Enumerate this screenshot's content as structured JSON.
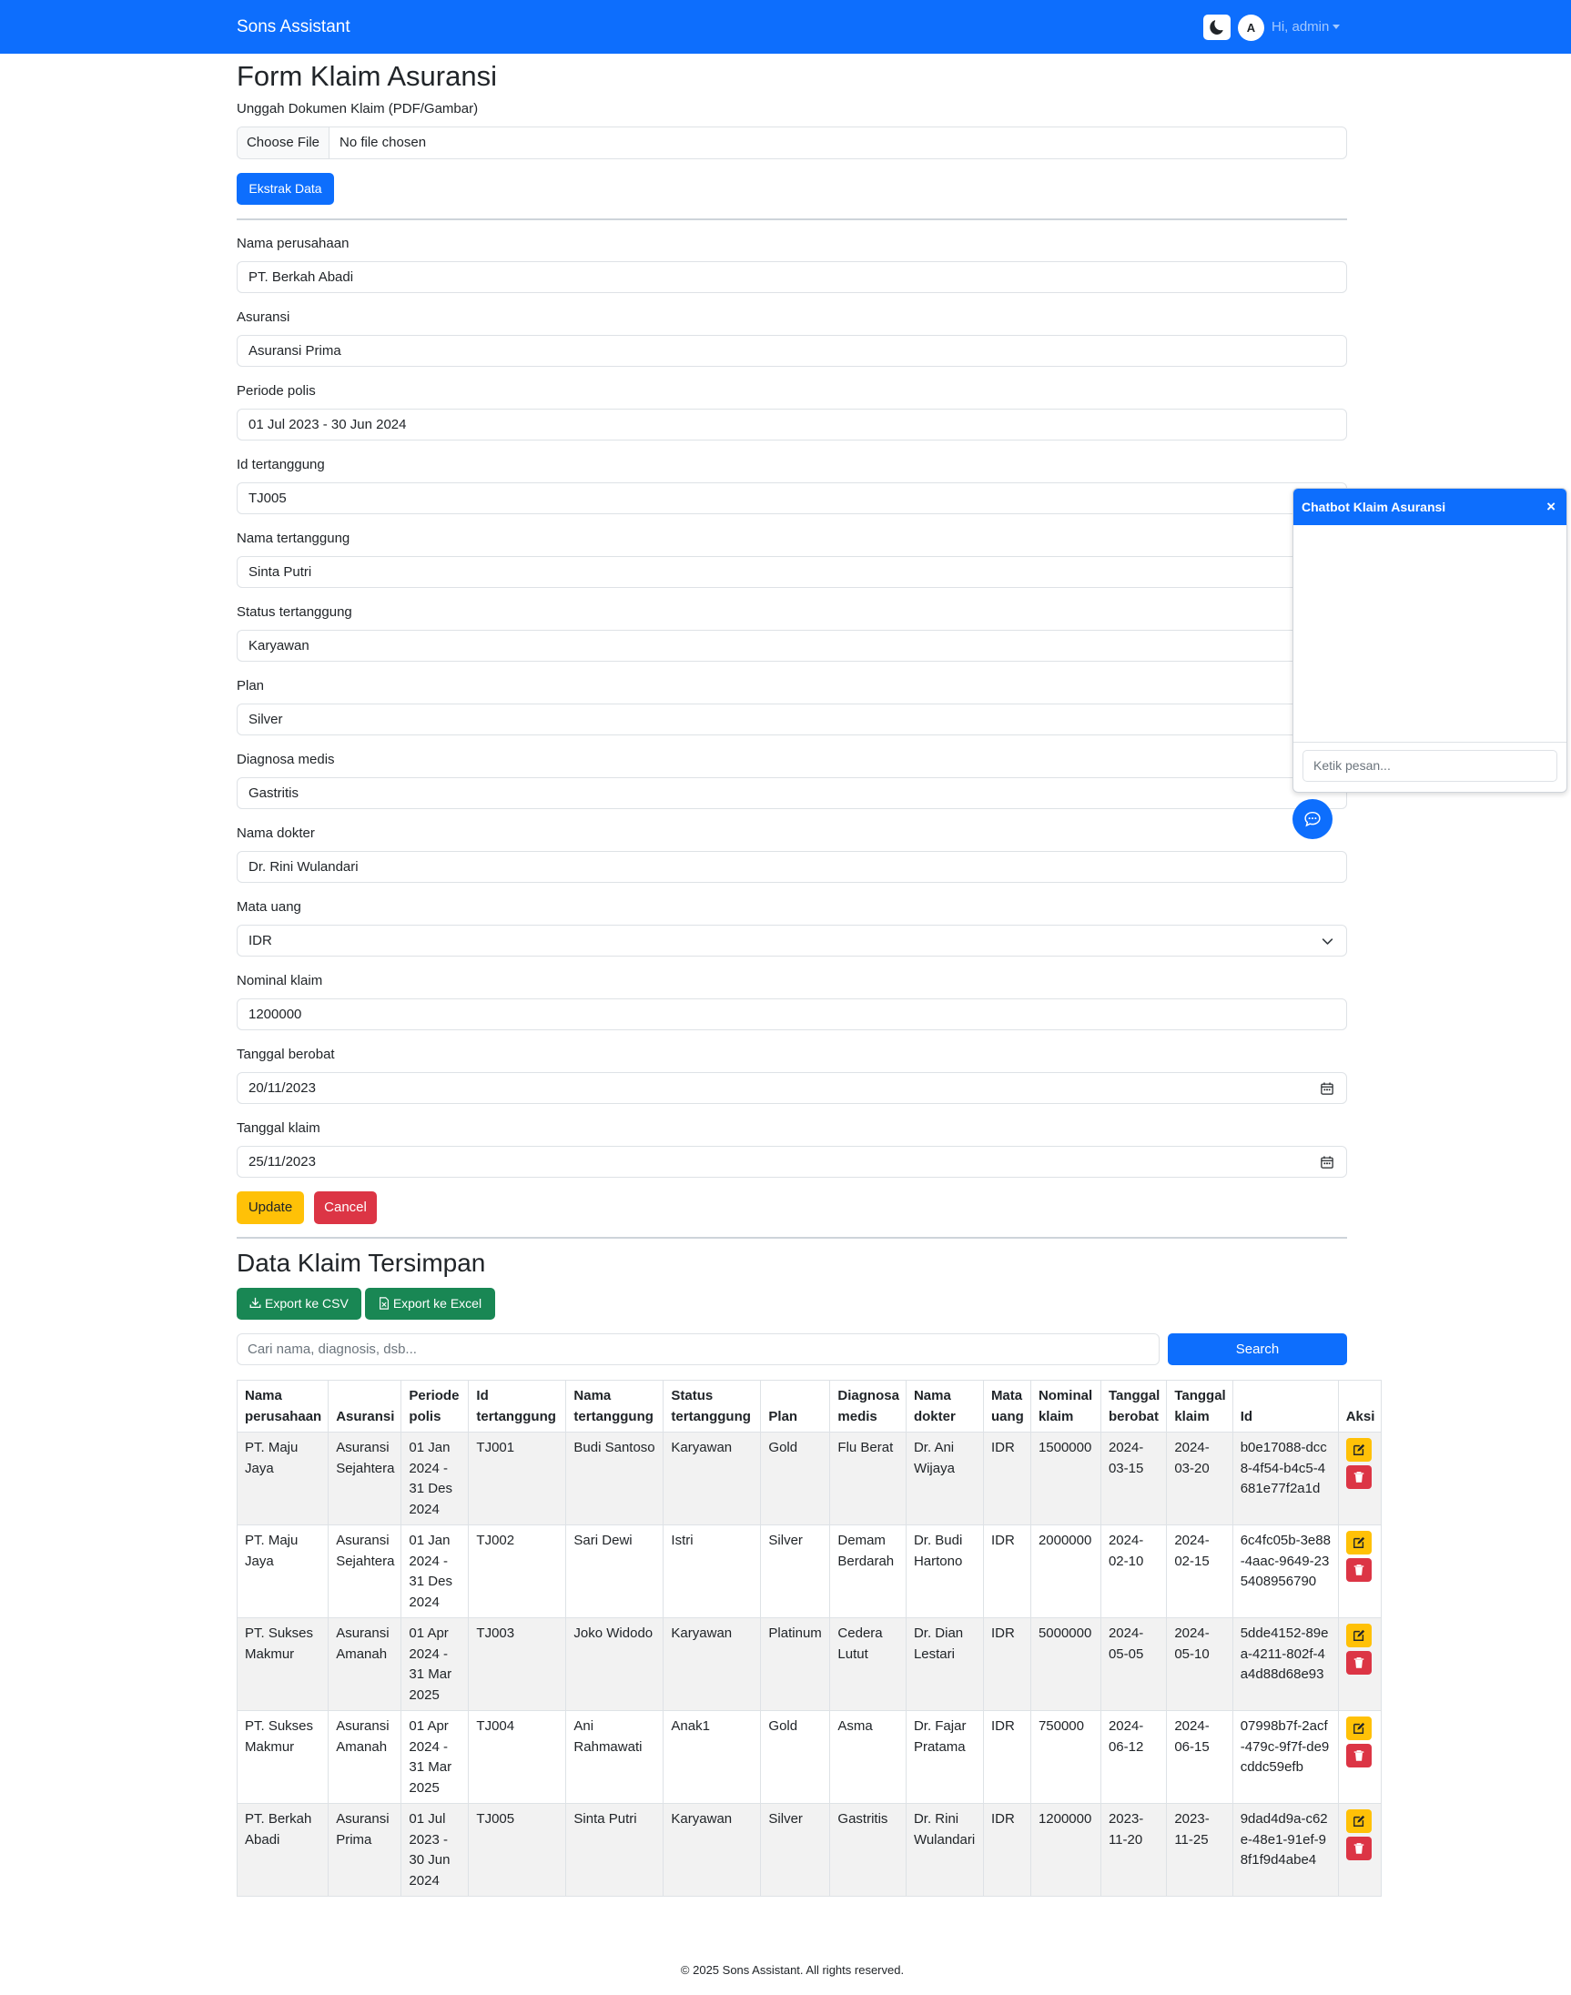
{
  "navbar": {
    "brand": "Sons Assistant",
    "avatar_initial": "A",
    "user_greeting": "Hi, admin"
  },
  "form": {
    "title": "Form Klaim Asuransi",
    "upload_label": "Unggah Dokumen Klaim (PDF/Gambar)",
    "file_button": "Choose File",
    "file_status": "No file chosen",
    "extract_button": "Ekstrak Data",
    "fields": {
      "nama_perusahaan": {
        "label": "Nama perusahaan",
        "value": "PT. Berkah Abadi"
      },
      "asuransi": {
        "label": "Asuransi",
        "value": "Asuransi Prima"
      },
      "periode_polis": {
        "label": "Periode polis",
        "value": "01 Jul 2023 - 30 Jun 2024"
      },
      "id_tertanggung": {
        "label": "Id tertanggung",
        "value": "TJ005"
      },
      "nama_tertanggung": {
        "label": "Nama tertanggung",
        "value": "Sinta Putri"
      },
      "status_tertanggung": {
        "label": "Status tertanggung",
        "value": "Karyawan"
      },
      "plan": {
        "label": "Plan",
        "value": "Silver"
      },
      "diagnosa_medis": {
        "label": "Diagnosa medis",
        "value": "Gastritis"
      },
      "nama_dokter": {
        "label": "Nama dokter",
        "value": "Dr. Rini Wulandari"
      },
      "mata_uang": {
        "label": "Mata uang",
        "value": "IDR"
      },
      "nominal_klaim": {
        "label": "Nominal klaim",
        "value": "1200000"
      },
      "tanggal_berobat": {
        "label": "Tanggal berobat",
        "value": "20/11/2023"
      },
      "tanggal_klaim": {
        "label": "Tanggal klaim",
        "value": "25/11/2023"
      }
    },
    "update_button": "Update",
    "cancel_button": "Cancel"
  },
  "saved": {
    "title": "Data Klaim Tersimpan",
    "export_csv": "Export ke CSV",
    "export_excel": "Export ke Excel",
    "search_placeholder": "Cari nama, diagnosis, dsb...",
    "search_button": "Search",
    "columns": [
      "Nama perusahaan",
      "Asuransi",
      "Periode polis",
      "Id tertanggung",
      "Nama tertanggung",
      "Status tertanggung",
      "Plan",
      "Diagnosa medis",
      "Nama dokter",
      "Mata uang",
      "Nominal klaim",
      "Tanggal berobat",
      "Tanggal klaim",
      "Id",
      "Aksi"
    ],
    "rows": [
      [
        "PT. Maju Jaya",
        "Asuransi Sejahtera",
        "01 Jan 2024 - 31 Des 2024",
        "TJ001",
        "Budi Santoso",
        "Karyawan",
        "Gold",
        "Flu Berat",
        "Dr. Ani Wijaya",
        "IDR",
        "1500000",
        "2024-03-15",
        "2024-03-20",
        "b0e17088-dcc8-4f54-b4c5-4681e77f2a1d"
      ],
      [
        "PT. Maju Jaya",
        "Asuransi Sejahtera",
        "01 Jan 2024 - 31 Des 2024",
        "TJ002",
        "Sari Dewi",
        "Istri",
        "Silver",
        "Demam Berdarah",
        "Dr. Budi Hartono",
        "IDR",
        "2000000",
        "2024-02-10",
        "2024-02-15",
        "6c4fc05b-3e88-4aac-9649-235408956790"
      ],
      [
        "PT. Sukses Makmur",
        "Asuransi Amanah",
        "01 Apr 2024 - 31 Mar 2025",
        "TJ003",
        "Joko Widodo",
        "Karyawan",
        "Platinum",
        "Cedera Lutut",
        "Dr. Dian Lestari",
        "IDR",
        "5000000",
        "2024-05-05",
        "2024-05-10",
        "5dde4152-89ea-4211-802f-4a4d88d68e93"
      ],
      [
        "PT. Sukses Makmur",
        "Asuransi Amanah",
        "01 Apr 2024 - 31 Mar 2025",
        "TJ004",
        "Ani Rahmawati",
        "Anak1",
        "Gold",
        "Asma",
        "Dr. Fajar Pratama",
        "IDR",
        "750000",
        "2024-06-12",
        "2024-06-15",
        "07998b7f-2acf-479c-9f7f-de9cddc59efb"
      ],
      [
        "PT. Berkah Abadi",
        "Asuransi Prima",
        "01 Jul 2023 - 30 Jun 2024",
        "TJ005",
        "Sinta Putri",
        "Karyawan",
        "Silver",
        "Gastritis",
        "Dr. Rini Wulandari",
        "IDR",
        "1200000",
        "2023-11-20",
        "2023-11-25",
        "9dad4d9a-c62e-48e1-91ef-98f1f9d4abe4"
      ]
    ]
  },
  "chat": {
    "title": "Chatbot Klaim Asuransi",
    "close_glyph": "×",
    "input_placeholder": "Ketik pesan..."
  },
  "footer": {
    "text": "© 2025 Sons Assistant. All rights reserved."
  }
}
